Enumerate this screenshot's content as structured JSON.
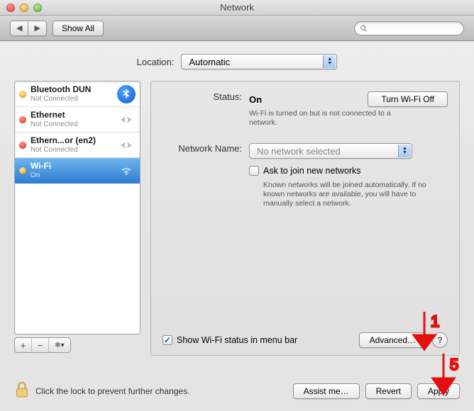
{
  "window": {
    "title": "Network"
  },
  "toolbar": {
    "back_label": "◀",
    "fwd_label": "▶",
    "showall_label": "Show All",
    "search_placeholder": ""
  },
  "location": {
    "label": "Location:",
    "selected": "Automatic"
  },
  "sidebar": {
    "items": [
      {
        "name": "Bluetooth DUN",
        "status": "Not Connected",
        "dot": "y",
        "icon": "bluetooth"
      },
      {
        "name": "Ethernet",
        "status": "Not Connected",
        "dot": "r",
        "icon": "ethernet"
      },
      {
        "name": "Ethern...or (en2)",
        "status": "Not Connected",
        "dot": "r",
        "icon": "ethernet"
      },
      {
        "name": "Wi-Fi",
        "status": "On",
        "dot": "y",
        "icon": "wifi",
        "selected": true
      }
    ],
    "add_label": "+",
    "remove_label": "−",
    "gear_label": "✻▾"
  },
  "detail": {
    "status_label": "Status:",
    "status_value": "On",
    "status_help": "Wi-Fi is turned on but is not connected to a network.",
    "turn_off_label": "Turn Wi-Fi Off",
    "network_name_label": "Network Name:",
    "network_name_value": "No network selected",
    "ask_join_label": "Ask to join new networks",
    "ask_join_help": "Known networks will be joined automatically. If no known networks are available, you will have to manually select a network.",
    "show_menubar_label": "Show Wi-Fi status in menu bar",
    "advanced_label": "Advanced…",
    "help_label": "?"
  },
  "bottom": {
    "lock_text": "Click the lock to prevent further changes.",
    "assist_label": "Assist me…",
    "revert_label": "Revert",
    "apply_label": "Apply"
  },
  "annotations": {
    "one": "1",
    "five": "5"
  }
}
